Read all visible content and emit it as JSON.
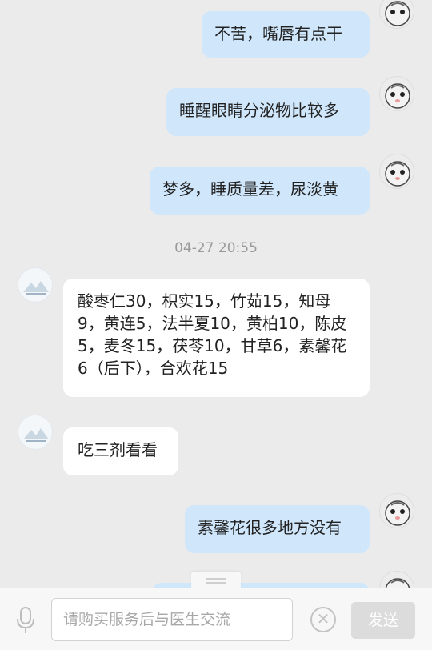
{
  "messages": [
    {
      "side": "out",
      "text": "不苦，嘴唇有点干"
    },
    {
      "side": "out",
      "text": "睡醒眼睛分泌物比较多"
    },
    {
      "side": "out",
      "text": "梦多，睡质量差，尿淡黄"
    },
    {
      "side": "in",
      "text": "酸枣仁30，枳实15，竹茹15，知母9，黄连5，法半夏10，黄柏10，陈皮5，麦冬15，茯苓10，甘草6，素馨花6（后下），合欢花15"
    },
    {
      "side": "in",
      "text": "吃三剂看看"
    },
    {
      "side": "out",
      "text": "素馨花很多地方没有"
    }
  ],
  "timestamp": "04-27 20:55",
  "input": {
    "placeholder": "请购买服务后与医生交流"
  },
  "send_label": "发送",
  "icons": {
    "mic": "microphone-icon",
    "clear": "clear-icon"
  },
  "colors": {
    "outgoing_bubble": "#cfe6fb",
    "incoming_bubble": "#ffffff",
    "background": "#ebebeb"
  }
}
